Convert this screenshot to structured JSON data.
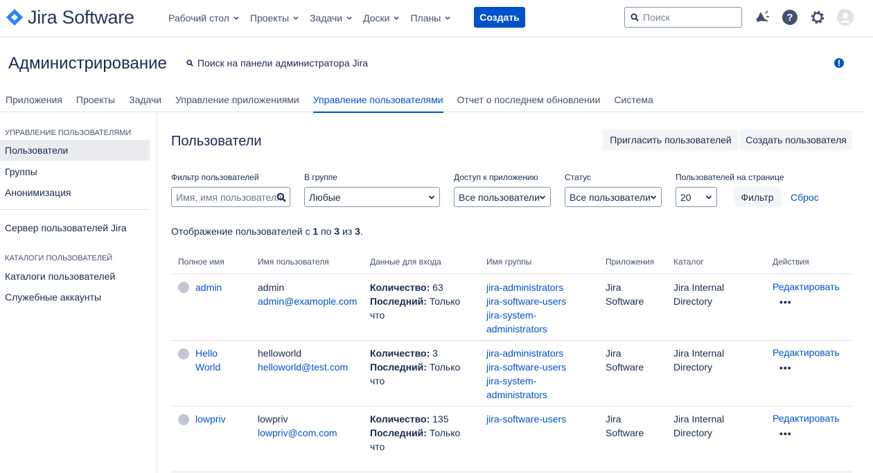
{
  "topbar": {
    "logo_text": "Jira Software",
    "nav": [
      {
        "label": "Рабочий стол"
      },
      {
        "label": "Проекты"
      },
      {
        "label": "Задачи"
      },
      {
        "label": "Доски"
      },
      {
        "label": "Планы"
      }
    ],
    "create_label": "Создать",
    "search_placeholder": "Поиск",
    "icons": [
      "megaphone-icon",
      "help-icon",
      "settings-icon",
      "avatar-icon"
    ],
    "accent": "#0052cc"
  },
  "header": {
    "title": "Администрирование",
    "admin_search": "Поиск на панели администратора Jira"
  },
  "tabs": [
    {
      "label": "Приложения"
    },
    {
      "label": "Проекты"
    },
    {
      "label": "Задачи"
    },
    {
      "label": "Управление приложениями"
    },
    {
      "label": "Управление пользователями",
      "active": true
    },
    {
      "label": "Отчет о последнем обновлении"
    },
    {
      "label": "Система"
    }
  ],
  "sidebar": {
    "section1": "УПРАВЛЕНИЕ ПОЛЬЗОВАТЕЛЯМИ",
    "items1": [
      {
        "label": "Пользователи",
        "active": true
      },
      {
        "label": "Группы"
      },
      {
        "label": "Анонимизация"
      }
    ],
    "server_item": "Сервер пользователей Jira",
    "section2": "КАТАЛОГИ ПОЛЬЗОВАТЕЛЕЙ",
    "items2": [
      {
        "label": "Каталоги пользователей"
      },
      {
        "label": "Служебные аккаунты"
      }
    ]
  },
  "main": {
    "title": "Пользователи",
    "invite_label": "Пригласить пользователей",
    "create_user_label": "Создать пользователя",
    "filters": {
      "user_filter_label": "Фильтр пользователей",
      "user_filter_placeholder": "Имя, имя пользователя",
      "group_label": "В группе",
      "group_value": "Любые",
      "app_access_label": "Доступ к приложению",
      "app_access_value": "Все пользователи",
      "status_label": "Статус",
      "status_value": "Все пользователи",
      "per_page_label": "Пользователей на странице",
      "per_page_value": "20",
      "filter_button": "Фильтр",
      "reset_link": "Сброс"
    },
    "showing": {
      "prefix": "Отображение пользователей с",
      "from": "1",
      "mid1": "по",
      "to": "3",
      "mid2": "из",
      "total": "3",
      "suffix": "."
    },
    "columns": [
      "Полное имя",
      "Имя пользователя",
      "Данные для входа",
      "Имя группы",
      "Приложения",
      "Каталог",
      "Действия"
    ],
    "rows": [
      {
        "full_name": "admin",
        "username": "admin",
        "email": "admin@examople.com",
        "count_label": "Количество:",
        "count": "63",
        "last_label": "Последний:",
        "last": "Только что",
        "groups": [
          "jira-administrators",
          "jira-software-users",
          "jira-system-administrators"
        ],
        "app": "Jira Software",
        "directory": "Jira Internal Directory",
        "edit": "Редактировать",
        "more": "•••"
      },
      {
        "full_name": "Hello World",
        "username": "helloworld",
        "email": "helloworld@test.com",
        "count_label": "Количество:",
        "count": "3",
        "last_label": "Последний:",
        "last": "Только что",
        "groups": [
          "jira-administrators",
          "jira-software-users",
          "jira-system-administrators"
        ],
        "app": "Jira Software",
        "directory": "Jira Internal Directory",
        "edit": "Редактировать",
        "more": "•••"
      },
      {
        "full_name": "lowpriv",
        "username": "lowpriv",
        "email": "lowpriv@com.com",
        "count_label": "Количество:",
        "count": "135",
        "last_label": "Последний:",
        "last": "Только что",
        "groups": [
          "jira-software-users"
        ],
        "app": "Jira Software",
        "directory": "Jira Internal Directory",
        "edit": "Редактировать",
        "more": "•••"
      }
    ]
  }
}
